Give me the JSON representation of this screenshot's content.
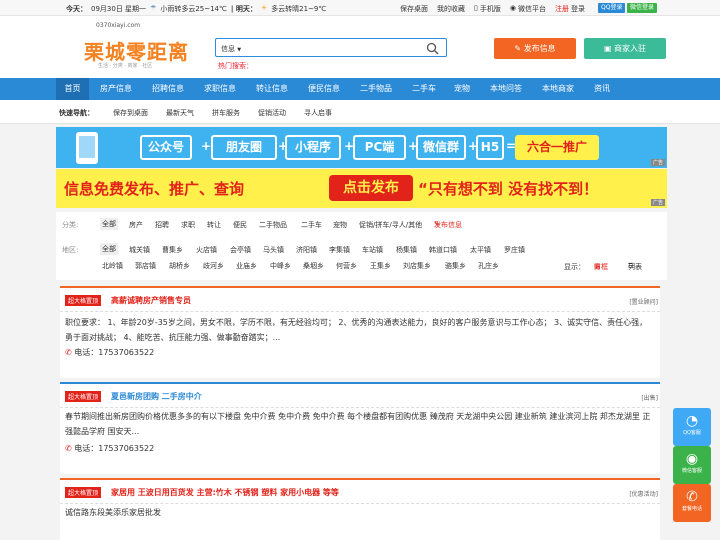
{
  "topbar": {
    "today_label": "今天：",
    "date": "09月30日 星期一",
    "weather_today": "小雨转多云25~14℃",
    "tomorrow_label": "| 明天：",
    "weather_tomorrow": "多云转晴21~9℃",
    "links": [
      "保存桌面",
      "我的收藏",
      "手机版",
      "微信平台"
    ],
    "register": "注册",
    "login": "登录",
    "qq_login": "QQ登录",
    "wechat_login": "微信登录"
  },
  "header": {
    "logo_text": "栗城零距离",
    "logo_url": "0370xiayi.com",
    "logo_slogan": "生活 · 分类 · 商家 · 社区",
    "search_category": "信息",
    "search_placeholder": "",
    "hot_search": "热门搜索：",
    "publish_button": "发布信息",
    "merchant_button": "商家入驻"
  },
  "nav": [
    "首页",
    "房产信息",
    "招聘信息",
    "求职信息",
    "转让信息",
    "便民信息",
    "二手物品",
    "二手车",
    "宠物",
    "本地问答",
    "本地商家",
    "资讯"
  ],
  "quick": {
    "label": "快速导航：",
    "links": [
      "保存到桌面",
      "最新天气",
      "拼车服务",
      "促销活动",
      "寻人启事"
    ]
  },
  "banner1": {
    "items": [
      "公众号",
      "朋友圈",
      "小程序",
      "PC端",
      "微信群",
      "H5",
      "六合一推广"
    ],
    "ad": "广告"
  },
  "banner2": {
    "text_left": "信息免费发布、推广、查询",
    "button": "点击发布",
    "text_right": "“只有想不到 没有找不到！",
    "ad": "广告"
  },
  "filter": {
    "category_label": "分类:",
    "categories": [
      "全部",
      "房产",
      "招聘",
      "求职",
      "转让",
      "便民",
      "二手物品",
      "二手车",
      "宠物",
      "促销/拼车/寻人/其他"
    ],
    "publish_link": "发布信息",
    "region_label": "地区:",
    "regions_row1": [
      "全部",
      "城关镇",
      "曹集乡",
      "火店镇",
      "会亭镇",
      "马头镇",
      "济阳镇",
      "李集镇",
      "车站镇",
      "杨集镇",
      "韩道口镇",
      "太平镇",
      "罗庄镇"
    ],
    "regions_row2": [
      "北岭镇",
      "郭店镇",
      "胡桥乡",
      "歧河乡",
      "业庙乡",
      "中峰乡",
      "桑堌乡",
      "何营乡",
      "王集乡",
      "刘店集乡",
      "骆集乡",
      "孔庄乡"
    ],
    "display_label": "显示：",
    "view_grid": "方框",
    "view_list": "列表"
  },
  "listings": [
    {
      "badge": "超大格置顶",
      "title": "高薪诚聘房产销售专员",
      "tag": "[置业顾问]",
      "body": "职位要求：  1、年龄20岁-35岁之间，男女不限，学历不限，有无经验均可； 2、优秀的沟通表达能力，良好的客户服务意识与工作心态； 3、诚实守信、责任心强，勇于面对挑战； 4、能吃苦、抗压能力强、做事勤奋踏实；...",
      "phone": "电话：17537063522"
    },
    {
      "badge": "超大格置顶",
      "title": "夏邑新房团购 二手房中介",
      "tag": "[出售]",
      "body": "春节期间推出新房团购价格优惠多多的有以下楼盘 免中介费 免中介费 免中介费 每个楼盘都有团购优惠 臻茂府 天龙湖中央公园 建业新筑 建业滨河上院 邦杰龙湖里 正强懿品学府 国安天...",
      "phone": "电话：17537063522"
    },
    {
      "badge": "超大格置顶",
      "title": "家居用 王波日用百货发 主营:竹木 不锈钢 塑料 家用小电器 等等",
      "tag": "[优惠活动]",
      "body": "诚信路东段美添乐家居批发",
      "phone": ""
    }
  ],
  "side": [
    "QQ客服",
    "微信客服",
    "套餐电话"
  ]
}
